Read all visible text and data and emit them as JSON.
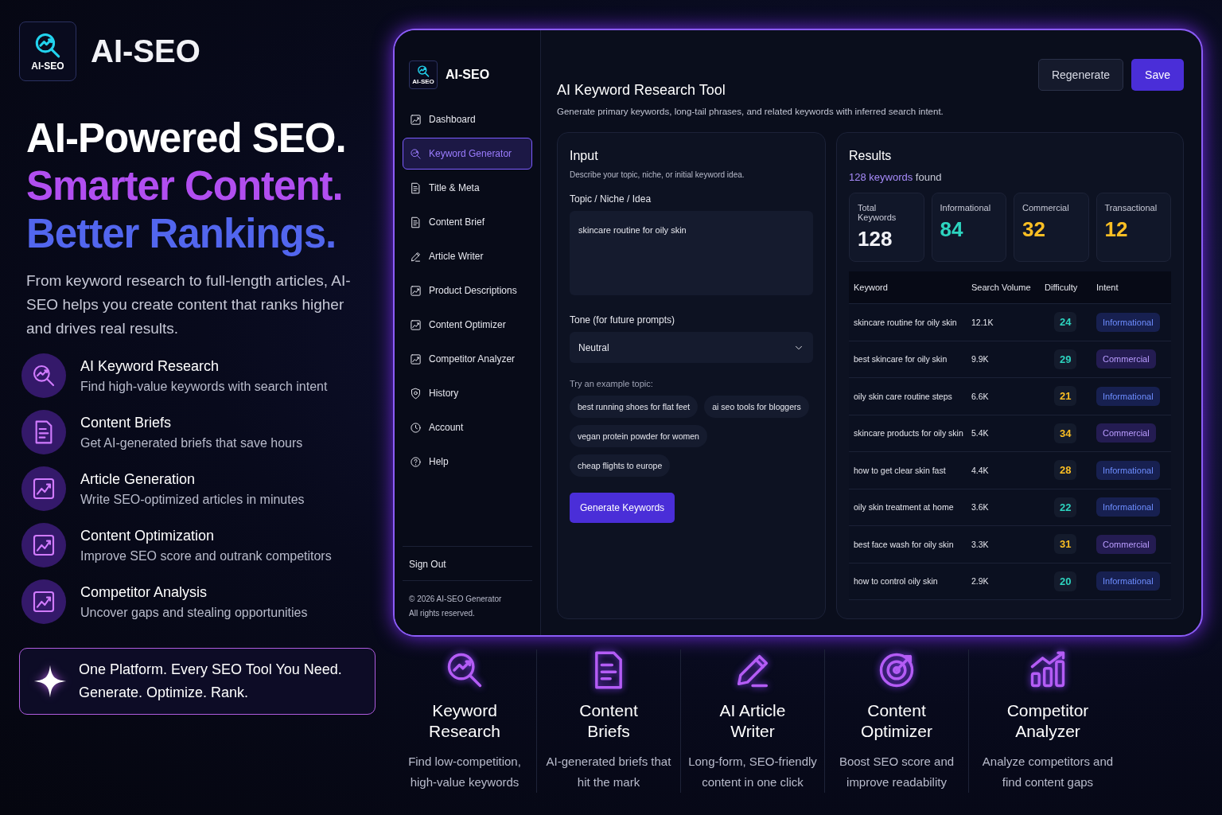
{
  "brand": {
    "name": "AI-SEO",
    "logo_text": "AI-SEO"
  },
  "hero": {
    "lines": [
      {
        "text": "AI-Powered SEO.",
        "kind": "plain"
      },
      {
        "text": "Smarter Content.",
        "kind": "purple"
      },
      {
        "text": "Better Rankings.",
        "kind": "blue"
      }
    ],
    "description": "From keyword research to full-length articles, AI-SEO helps you create content that ranks higher and drives real results."
  },
  "features": [
    {
      "title": "AI Keyword Research",
      "subtitle": "Find high-value keywords with search intent"
    },
    {
      "title": "Content Briefs",
      "subtitle": "Get AI-generated briefs that save hours"
    },
    {
      "title": "Article Generation",
      "subtitle": "Write SEO-optimized articles in minutes"
    },
    {
      "title": "Content Optimization",
      "subtitle": "Improve SEO score and outrank competitors"
    },
    {
      "title": "Competitor Analysis",
      "subtitle": "Uncover gaps and stealing opportunities"
    }
  ],
  "callout": {
    "lines": [
      "One Platform. Every SEO Tool You Need.",
      "Generate. Optimize. Rank."
    ]
  },
  "app": {
    "sidebar": {
      "brand": "AI-SEO",
      "logo_text": "AI-SEO",
      "items": [
        {
          "label": "Dashboard",
          "selected": false
        },
        {
          "label": "Keyword Generator",
          "selected": true
        },
        {
          "label": "Title & Meta",
          "selected": false
        },
        {
          "label": "Content Brief",
          "selected": false
        },
        {
          "label": "Article Writer",
          "selected": false
        },
        {
          "label": "Product Descriptions",
          "selected": false
        },
        {
          "label": "Content Optimizer",
          "selected": false
        },
        {
          "label": "Competitor Analyzer",
          "selected": false
        },
        {
          "label": "History",
          "selected": false
        },
        {
          "label": "Account",
          "selected": false
        },
        {
          "label": "Help",
          "selected": false
        }
      ],
      "sign_out": "Sign Out",
      "footer": [
        "© 2026 AI-SEO Generator",
        "All rights reserved."
      ]
    },
    "header": {
      "title": "AI Keyword Research Tool",
      "subtitle": "Generate primary keywords, long-tail phrases, and related keywords with inferred search intent.",
      "buttons": [
        {
          "label": "Regenerate",
          "kind": "secondary"
        },
        {
          "label": "Save",
          "kind": "primary"
        }
      ]
    },
    "input": {
      "title": "Input",
      "subtitle": "Describe your topic, niche, or initial keyword idea.",
      "topic_label": "Topic / Niche / Idea",
      "topic_value": "skincare routine for oily skin",
      "tone_label": "Tone (for future prompts)",
      "tone_value": "Neutral",
      "examples_label": "Try an example topic:",
      "examples": [
        "best running shoes for flat feet",
        "ai seo tools for bloggers",
        "vegan protein powder for women",
        "cheap flights to europe"
      ],
      "generate_button": "Generate Keywords"
    },
    "results": {
      "title": "Results",
      "count_text": "128 keywords",
      "count_suffix": "found",
      "stats": [
        {
          "label": "Total Keywords",
          "value": "128",
          "color": "#f1f2f6"
        },
        {
          "label": "Informational",
          "value": "84",
          "color": "#2dd4bf"
        },
        {
          "label": "Commercial",
          "value": "32",
          "color": "#fbbf24"
        },
        {
          "label": "Transactional",
          "value": "12",
          "color": "#fbbf24"
        }
      ],
      "table": {
        "columns": [
          "Keyword",
          "Search Volume",
          "Difficulty",
          "Intent"
        ],
        "rows": [
          {
            "keyword": "skincare routine for oily skin",
            "volume": "12.1K",
            "difficulty": {
              "text": "24",
              "color": "#2dd4bf"
            },
            "intent": {
              "label": "Informational",
              "kind": "informational"
            }
          },
          {
            "keyword": "best skincare for oily skin",
            "volume": "9.9K",
            "difficulty": {
              "text": "29",
              "color": "#2dd4bf"
            },
            "intent": {
              "label": "Commercial",
              "kind": "commercial"
            }
          },
          {
            "keyword": "oily skin care routine steps",
            "volume": "6.6K",
            "difficulty": {
              "text": "21",
              "color": "#fbbf24"
            },
            "intent": {
              "label": "Informational",
              "kind": "informational"
            }
          },
          {
            "keyword": "skincare products for oily skin",
            "volume": "5.4K",
            "difficulty": {
              "text": "34",
              "color": "#fbbf24"
            },
            "intent": {
              "label": "Commercial",
              "kind": "commercial"
            }
          },
          {
            "keyword": "how to get clear skin fast",
            "volume": "4.4K",
            "difficulty": {
              "text": "28",
              "color": "#fbbf24"
            },
            "intent": {
              "label": "Informational",
              "kind": "informational"
            }
          },
          {
            "keyword": "oily skin treatment at home",
            "volume": "3.6K",
            "difficulty": {
              "text": "22",
              "color": "#2dd4bf"
            },
            "intent": {
              "label": "Informational",
              "kind": "informational"
            }
          },
          {
            "keyword": "best face wash for oily skin",
            "volume": "3.3K",
            "difficulty": {
              "text": "31",
              "color": "#fbbf24"
            },
            "intent": {
              "label": "Commercial",
              "kind": "commercial"
            }
          },
          {
            "keyword": "how to control oily skin",
            "volume": "2.9K",
            "difficulty": {
              "text": "20",
              "color": "#2dd4bf"
            },
            "intent": {
              "label": "Informational",
              "kind": "informational"
            }
          }
        ]
      }
    }
  },
  "tools": [
    {
      "title": "Keyword Research",
      "description": "Find low-competition, high-value keywords"
    },
    {
      "title": "Content Briefs",
      "description": "AI-generated briefs that hit the mark"
    },
    {
      "title": "AI Article Writer",
      "description": "Long-form, SEO-friendly content in one click"
    },
    {
      "title": "Content Optimizer",
      "description": "Boost SEO score and improve readability"
    },
    {
      "title": "Competitor Analyzer",
      "description": "Analyze competitors and find content gaps"
    }
  ]
}
